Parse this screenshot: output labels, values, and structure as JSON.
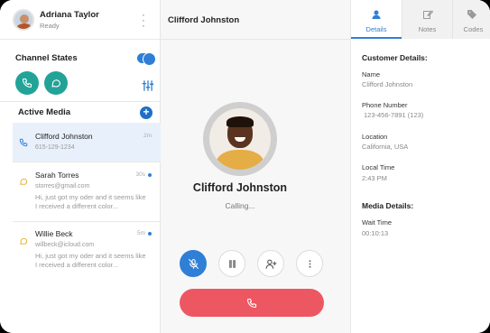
{
  "user": {
    "name": "Adriana Taylor",
    "status": "Ready"
  },
  "channel_states": {
    "title": "Channel States",
    "enabled": true
  },
  "active_media": {
    "title": "Active Media",
    "items": [
      {
        "name": "Clifford Johnston",
        "sub": "615-129-1234",
        "time": "2m",
        "type": "phone",
        "active": true
      },
      {
        "name": "Sarah Torres",
        "sub": "storres@gmail.com",
        "preview": "Hi, just got my oder and it seems like I received a different color...",
        "time": "30s",
        "type": "chat",
        "unread": true
      },
      {
        "name": "Willie Beck",
        "sub": "willbeck@icloud.com",
        "preview": "Hi, just got my oder and it seems like I received a different color...",
        "time": "5m",
        "type": "chat",
        "unread": true
      }
    ]
  },
  "call": {
    "title": "Clifford Johnston",
    "callee": "Clifford Johnston",
    "status": "Calling..."
  },
  "tabs": [
    {
      "label": "Details",
      "icon": "person-icon",
      "active": true
    },
    {
      "label": "Notes",
      "icon": "edit-icon",
      "active": false
    },
    {
      "label": "Codes",
      "icon": "tag-icon",
      "active": false
    }
  ],
  "customer": {
    "heading": "Customer Details:",
    "name_label": "Name",
    "name_value": "Clifford Johnston",
    "phone_label": "Phone Number",
    "phone_value": "123-456-7891 (123)",
    "location_label": "Location",
    "location_value": "California, USA",
    "time_label": "Local Time",
    "time_value": "2:43 PM"
  },
  "media_details": {
    "heading": "Media Details:",
    "wait_label": "Wait Time",
    "wait_value": "00:10:13"
  },
  "colors": {
    "accent": "#2f7fd6",
    "teal": "#23a397",
    "end_call": "#ec5762"
  }
}
